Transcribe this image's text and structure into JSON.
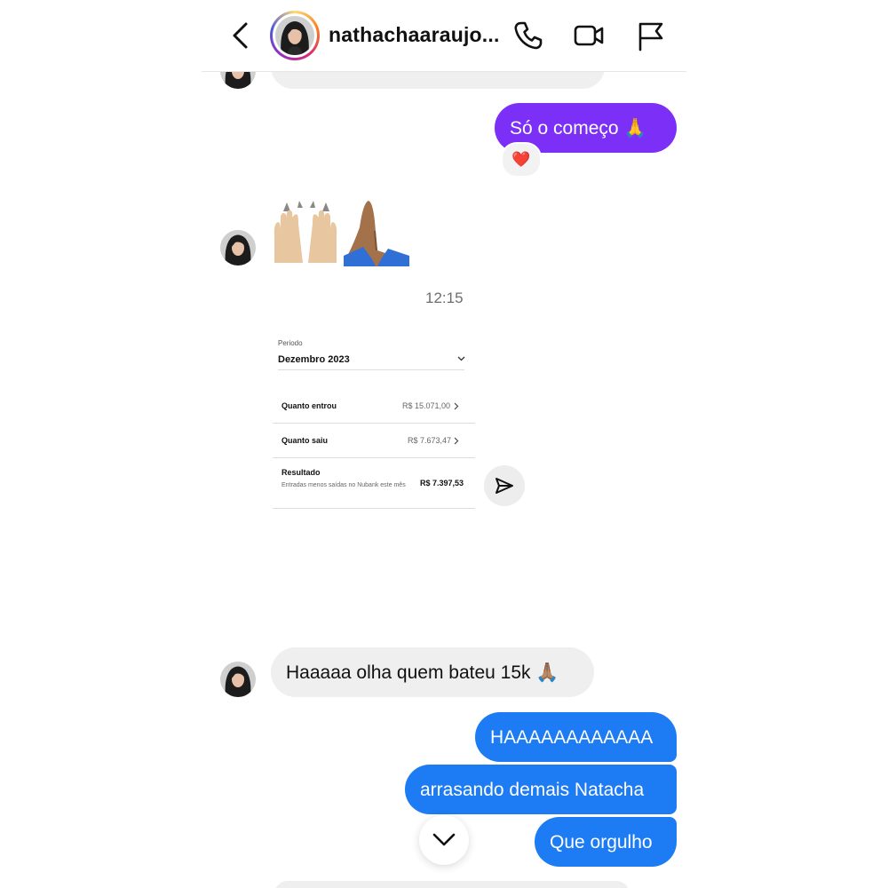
{
  "header": {
    "username": "nathachaaraujo...",
    "back_icon": "chevron-left-icon",
    "call_icon": "phone-icon",
    "video_icon": "video-camera-icon",
    "report_icon": "flag-icon"
  },
  "messages": [
    {
      "id": "m1",
      "direction": "outgoing",
      "text": "Só o começo 🙏",
      "color": "#7b2ff7",
      "reaction": "❤️"
    },
    {
      "id": "m2",
      "direction": "incoming",
      "text": "🙌🏼🙏🏽"
    },
    {
      "id": "m3",
      "type": "timestamp",
      "text": "12:15"
    },
    {
      "id": "m4",
      "direction": "incoming",
      "type": "shared-image",
      "image": {
        "period_label": "Periodo",
        "period_value": "Dezembro 2023",
        "rows": [
          {
            "label": "Quanto entrou",
            "value": "R$ 15.071,00"
          },
          {
            "label": "Quanto saiu",
            "value": "R$ 7.673,47"
          },
          {
            "label": "Resultado",
            "value": "R$ 7.397,53",
            "description": "Entradas menos saídas no Nubank este mês"
          }
        ]
      }
    },
    {
      "id": "m5",
      "direction": "incoming",
      "text": "Haaaaa olha quem bateu 15k 🙏🏽"
    },
    {
      "id": "m6",
      "direction": "outgoing",
      "text": "HAAAAAAAAAAAA",
      "color": "#1d7bf4"
    },
    {
      "id": "m7",
      "direction": "outgoing",
      "text": "arrasando demais Natacha",
      "color": "#1d7bf4"
    },
    {
      "id": "m8",
      "direction": "outgoing",
      "text": "Que orgulho",
      "color": "#1d7bf4"
    }
  ],
  "controls": {
    "share_icon": "paper-plane-icon",
    "scroll_down_icon": "chevron-down-icon"
  }
}
